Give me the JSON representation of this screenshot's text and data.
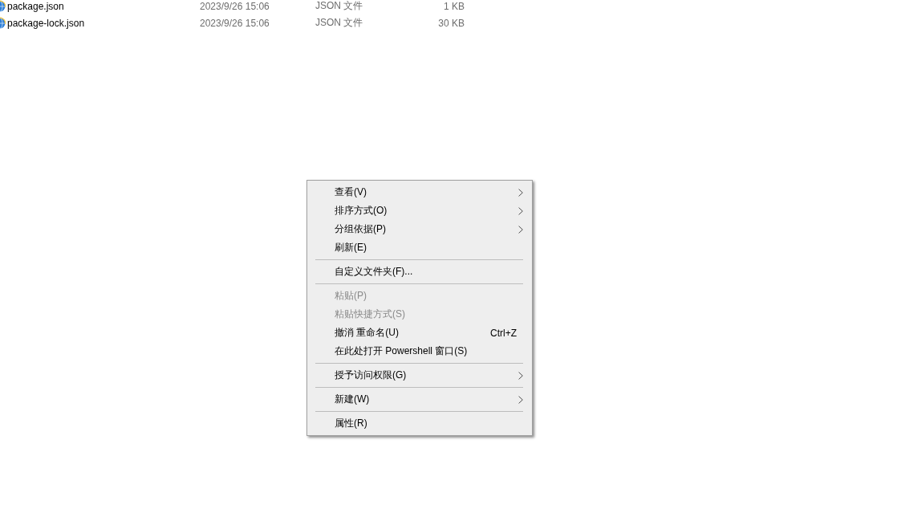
{
  "files": [
    {
      "name": "package.json",
      "modified": "2023/9/26 15:06",
      "type": "JSON 文件",
      "size": "1 KB"
    },
    {
      "name": "package-lock.json",
      "modified": "2023/9/26 15:06",
      "type": "JSON 文件",
      "size": "30 KB"
    }
  ],
  "context_menu": {
    "sections": [
      {
        "items": [
          {
            "label": "查看(V)",
            "submenu": true,
            "disabled": false
          },
          {
            "label": "排序方式(O)",
            "submenu": true,
            "disabled": false
          },
          {
            "label": "分组依据(P)",
            "submenu": true,
            "disabled": false
          },
          {
            "label": "刷新(E)",
            "submenu": false,
            "disabled": false
          }
        ]
      },
      {
        "items": [
          {
            "label": "自定义文件夹(F)...",
            "submenu": false,
            "disabled": false
          }
        ]
      },
      {
        "items": [
          {
            "label": "粘贴(P)",
            "submenu": false,
            "disabled": true
          },
          {
            "label": "粘贴快捷方式(S)",
            "submenu": false,
            "disabled": true
          },
          {
            "label": "撤消 重命名(U)",
            "shortcut": "Ctrl+Z",
            "submenu": false,
            "disabled": false
          },
          {
            "label": "在此处打开 Powershell 窗口(S)",
            "submenu": false,
            "disabled": false
          }
        ]
      },
      {
        "items": [
          {
            "label": "授予访问权限(G)",
            "submenu": true,
            "disabled": false
          }
        ]
      },
      {
        "items": [
          {
            "label": "新建(W)",
            "submenu": true,
            "disabled": false
          }
        ]
      },
      {
        "items": [
          {
            "label": "属性(R)",
            "submenu": false,
            "disabled": false
          }
        ]
      }
    ]
  }
}
